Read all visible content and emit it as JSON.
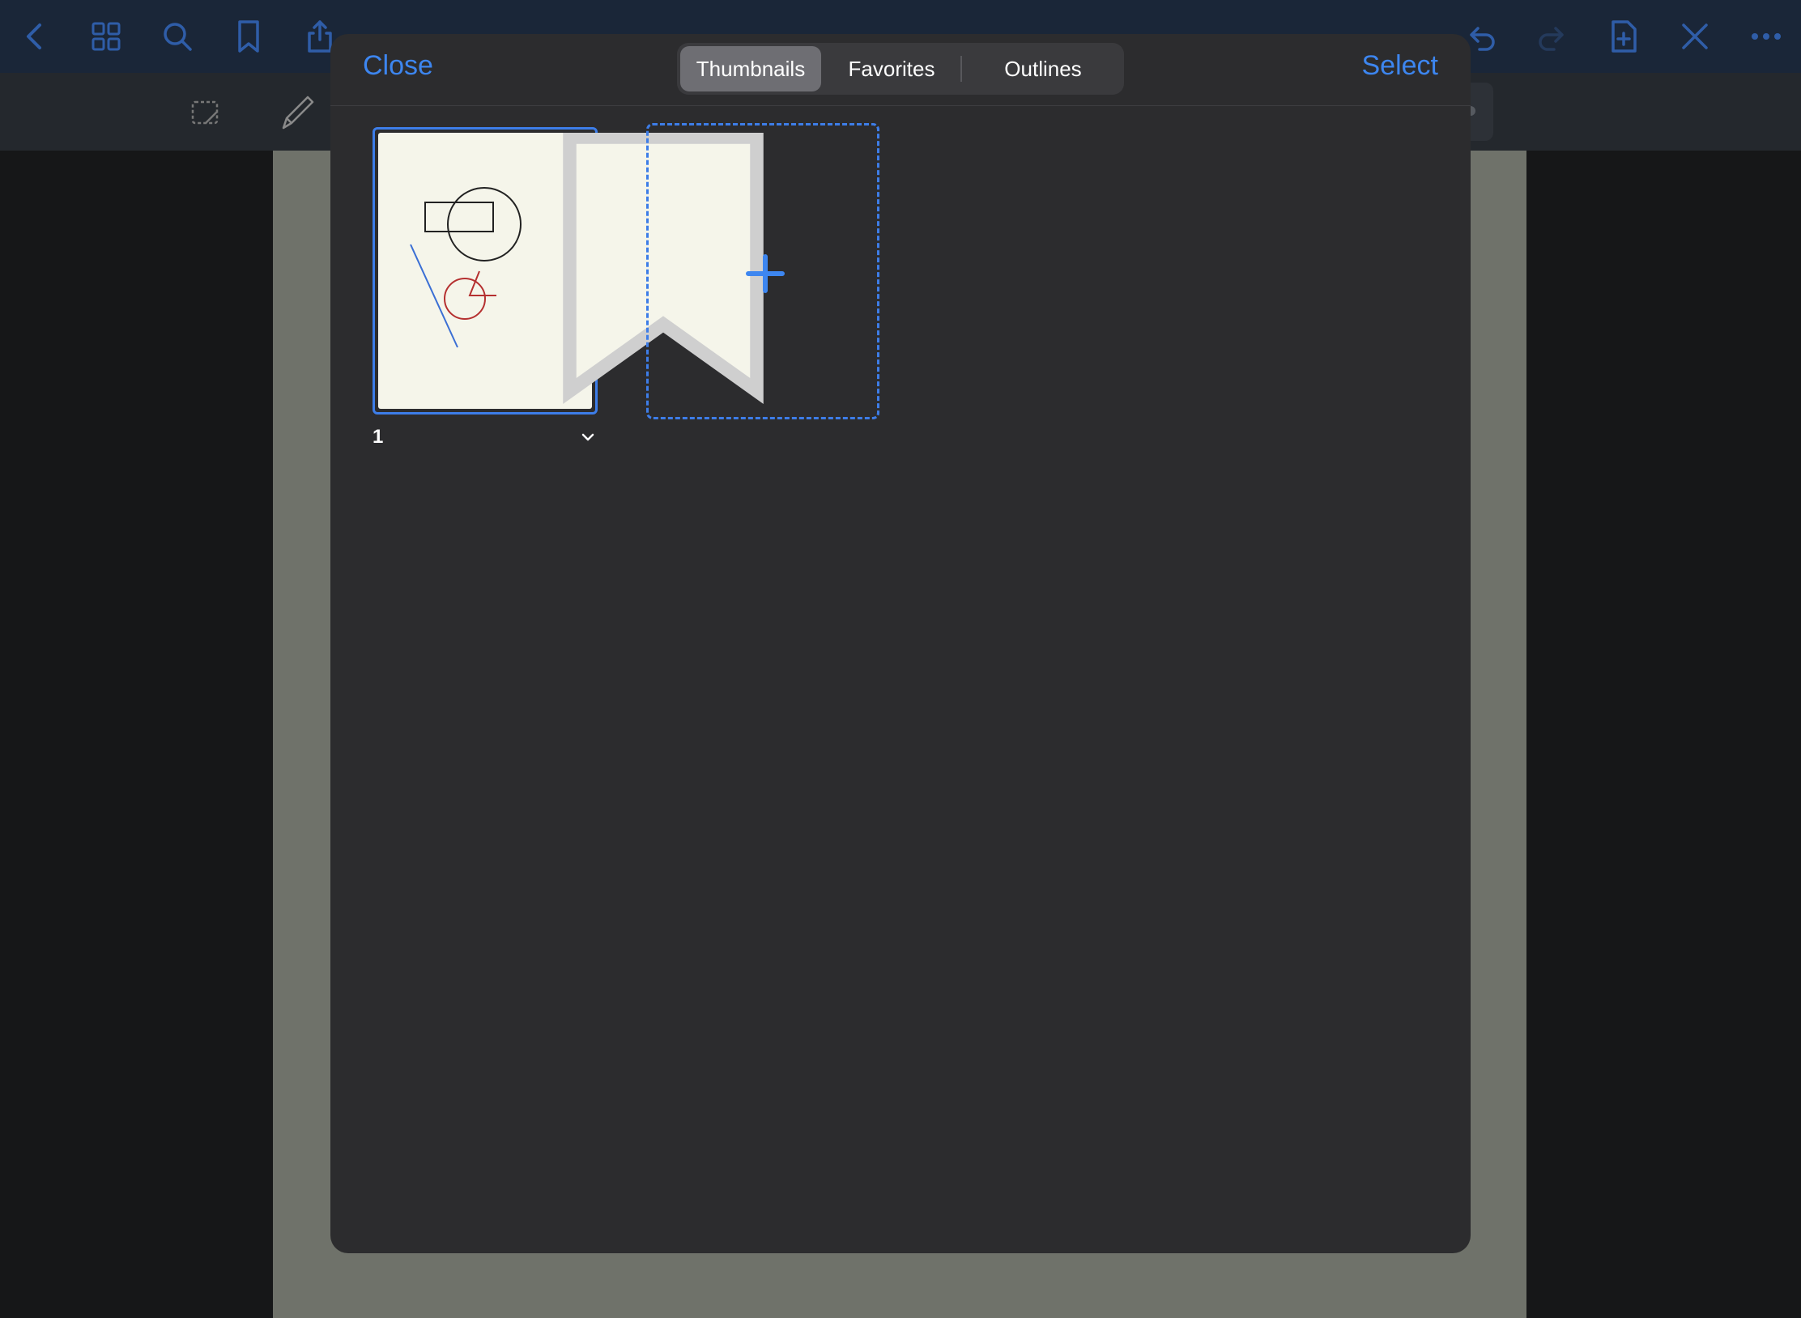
{
  "background_app": {
    "document_title": "",
    "top_icons": [
      "back-icon",
      "grid-icon",
      "search-icon",
      "bookmark-icon",
      "share-icon",
      "undo-icon",
      "redo-icon",
      "add-page-icon",
      "close-edit-icon",
      "more-icon"
    ],
    "tools": [
      "lasso-icon",
      "pen-icon"
    ]
  },
  "sheet": {
    "close_label": "Close",
    "select_label": "Select",
    "tabs": [
      {
        "label": "Thumbnails",
        "active": true
      },
      {
        "label": "Favorites",
        "active": false
      },
      {
        "label": "Outlines",
        "active": false
      }
    ],
    "pages": [
      {
        "number": "1",
        "selected": true
      }
    ],
    "add_page_icon": "plus-icon"
  },
  "colors": {
    "accent": "#3d86f0",
    "sheet_bg": "#2c2c2e",
    "page_bg": "#f5f5ea"
  }
}
